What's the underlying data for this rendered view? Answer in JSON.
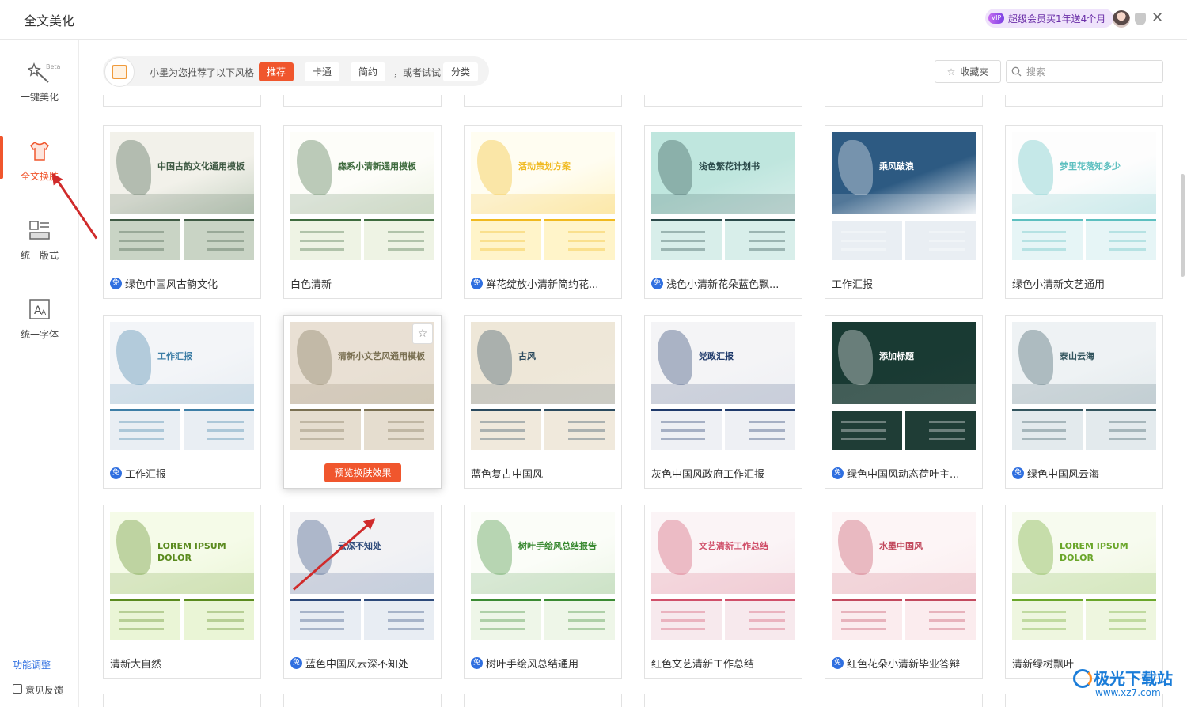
{
  "window": {
    "title": "全文美化",
    "vip_label": "超级会员买1年送4个月",
    "vip_icon": "vip-badge-icon",
    "close_icon": "close-icon"
  },
  "sidebar": {
    "items": [
      {
        "label": "一键美化",
        "icon": "magic-wand-icon",
        "badge": "Beta"
      },
      {
        "label": "全文换肤",
        "icon": "tshirt-icon",
        "active": true
      },
      {
        "label": "统一版式",
        "icon": "layout-icon"
      },
      {
        "label": "统一字体",
        "icon": "font-icon"
      }
    ],
    "feature_adjust": "功能调整",
    "feedback": "意见反馈"
  },
  "toolbar": {
    "recommend_text": "小墨为您推荐了以下风格",
    "chips": [
      "推荐",
      "卡通",
      "简约"
    ],
    "or_try": "，或者试试",
    "category": "分类",
    "favorites": "收藏夹",
    "search_placeholder": "搜索"
  },
  "preview_button": "预览换肤效果",
  "free_badge": "免",
  "templates": [
    {
      "title": "绿色中国风古韵文化",
      "free": true,
      "slide_title": "中国古韵文化通用模板",
      "palette": [
        "#f2f1ea",
        "#3f5a44",
        "#c9d4c5"
      ]
    },
    {
      "title": "白色清新",
      "free": false,
      "slide_title": "森系小清新通用模板",
      "palette": [
        "#fdfdf9",
        "#3e6b3e",
        "#eef3e4"
      ]
    },
    {
      "title": "鲜花绽放小清新简约花...",
      "free": true,
      "slide_title": "活动策划方案",
      "palette": [
        "#fffdf1",
        "#f0b91e",
        "#fff4c9"
      ]
    },
    {
      "title": "浅色小清新花朵蓝色飘...",
      "free": true,
      "slide_title": "浅色繁花计划书",
      "palette": [
        "#bfe6de",
        "#2b4a4a",
        "#d8eeea"
      ]
    },
    {
      "title": "工作汇报",
      "free": false,
      "slide_title": "乘风破浪",
      "palette": [
        "#2d5a82",
        "#ffffff",
        "#e9eef3"
      ]
    },
    {
      "title": "绿色小清新文艺通用",
      "free": false,
      "slide_title": "梦里花落知多少",
      "palette": [
        "#fdfdfd",
        "#5cbfbf",
        "#e6f5f6"
      ]
    },
    {
      "title": "工作汇报",
      "free": true,
      "slide_title": "工作汇报",
      "palette": [
        "#f3f5f8",
        "#3d7ea6",
        "#e9eef3"
      ]
    },
    {
      "title": "",
      "free": false,
      "slide_title": "清新小文艺风通用模板",
      "palette": [
        "#e9e0d4",
        "#7a7052",
        "#e5ddcf"
      ]
    },
    {
      "title": "蓝色复古中国风",
      "free": false,
      "slide_title": "古风",
      "palette": [
        "#eee7d8",
        "#2b4a5e",
        "#f0e9dc"
      ]
    },
    {
      "title": "灰色中国风政府工作汇报",
      "free": false,
      "slide_title": "党政汇报",
      "palette": [
        "#f4f4f6",
        "#1f3a6b",
        "#eef0f4"
      ]
    },
    {
      "title": "绿色中国风动态荷叶主...",
      "free": true,
      "slide_title": "添加标题",
      "palette": [
        "#193a33",
        "#ffffff",
        "#1f3d36"
      ]
    },
    {
      "title": "绿色中国风云海",
      "free": true,
      "slide_title": "泰山云海",
      "palette": [
        "#eef2f4",
        "#33555e",
        "#e3eaed"
      ]
    },
    {
      "title": "清新大自然",
      "free": false,
      "slide_title": "LOREM IPSUM DOLOR",
      "palette": [
        "#f5fbe8",
        "#5a8a1e",
        "#eaf5d6"
      ]
    },
    {
      "title": "蓝色中国风云深不知处",
      "free": true,
      "slide_title": "云深不知处",
      "palette": [
        "#f2f2f4",
        "#2d4a7a",
        "#e8edf3"
      ]
    },
    {
      "title": "树叶手绘风总结通用",
      "free": true,
      "slide_title": "树叶手绘风总结报告",
      "palette": [
        "#fbfdf8",
        "#3a8a32",
        "#eef6e8"
      ]
    },
    {
      "title": "红色文艺清新工作总结",
      "free": false,
      "slide_title": "文艺清新工作总结",
      "palette": [
        "#fbf4f6",
        "#d0506a",
        "#f7e9ed"
      ]
    },
    {
      "title": "红色花朵小清新毕业答辩",
      "free": true,
      "slide_title": "水墨中国风",
      "palette": [
        "#fdf5f6",
        "#c24a5e",
        "#fbecee"
      ]
    },
    {
      "title": "清新绿树飘叶",
      "free": false,
      "slide_title": "LOREM IPSUM DOLOR",
      "palette": [
        "#f7fbef",
        "#6aa62a",
        "#eef6df"
      ]
    }
  ],
  "watermark": {
    "line1": "极光下载站",
    "line2": "www.xz7.com"
  },
  "accent_color": "#f0562d",
  "arrow_color": "#d02b2b"
}
